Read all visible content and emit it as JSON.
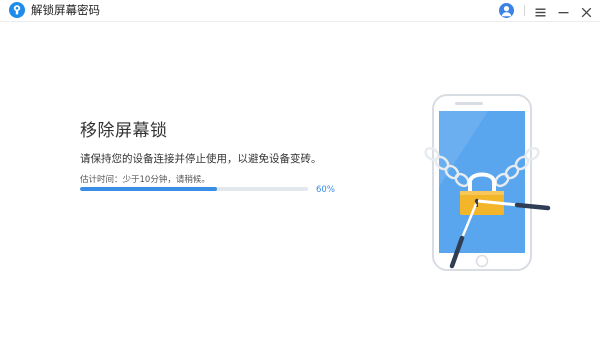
{
  "window": {
    "title": "解锁屏幕密码",
    "icons": {
      "app": "app-logo-icon",
      "user": "user-icon",
      "menu": "hamburger-menu-icon",
      "minimize": "minimize-icon",
      "close": "close-icon"
    }
  },
  "main": {
    "heading": "移除屏幕锁",
    "instruction": "请保持您的设备连接并停止使用，以避免设备变砖。",
    "estimate": "估计时间：少于10分钟，请稍候。",
    "progress": {
      "value": 0.6,
      "label": "60%"
    }
  },
  "illustration": {
    "subject": "phone-with-chain-and-padlock",
    "icons": [
      "phone-icon",
      "chain-icon",
      "padlock-icon",
      "key-icon",
      "unlock-tool-icon"
    ]
  },
  "colors": {
    "accent": "#3a8ee6",
    "progress_track": "#e3e8ee",
    "padlock": "#f3b52a",
    "phone_screen": "#5aa6ee"
  }
}
